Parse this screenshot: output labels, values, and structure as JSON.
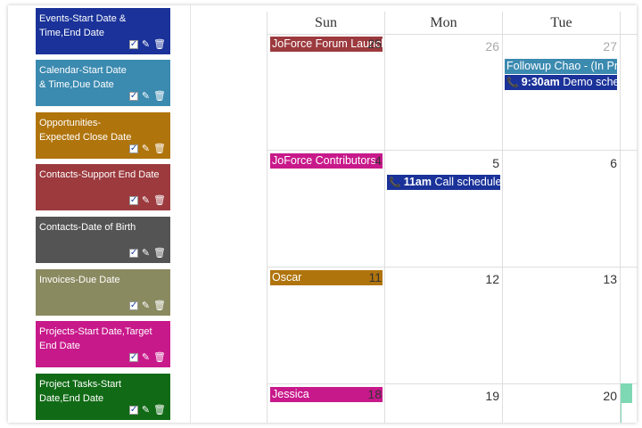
{
  "feeds": [
    {
      "label": "Events-Start Date & Time,End Date",
      "color": "#1a3299"
    },
    {
      "label": "Calendar-Start Date & Time,Due Date",
      "color": "#3b8ab0"
    },
    {
      "label": "Opportunities-Expected Close Date",
      "color": "#b0740c"
    },
    {
      "label": "Contacts-Support End Date",
      "color": "#9c3a3e"
    },
    {
      "label": "Contacts-Date of Birth",
      "color": "#545454"
    },
    {
      "label": "Invoices-Due Date",
      "color": "#8a8a60"
    },
    {
      "label": "Projects-Start Date,Target End Date",
      "color": "#c8198b"
    },
    {
      "label": "Project Tasks-Start Date,End Date",
      "color": "#116b16"
    }
  ],
  "calendar": {
    "headers": [
      "Sun",
      "Mon",
      "Tue"
    ],
    "weeks": [
      {
        "days": [
          "25",
          "26",
          "27"
        ]
      },
      {
        "days": [
          "4",
          "5",
          "6"
        ]
      },
      {
        "days": [
          "11",
          "12",
          "13"
        ]
      },
      {
        "days": [
          "18",
          "19",
          "20"
        ]
      }
    ],
    "events": {
      "w1_sun": {
        "title": "JoForce Forum Launch",
        "color": "#9c3a3e"
      },
      "w1_tue_a": {
        "title": "Followup Chao - (In Progress)",
        "color": "#3b8ab0"
      },
      "w1_tue_b": {
        "time": "9:30am",
        "title": "Demo schedule",
        "color": "#1a3299"
      },
      "w2_sun": {
        "title": "JoForce Contributors",
        "color": "#c8198b"
      },
      "w2_mon": {
        "time": "11am",
        "title": "Call schedule",
        "color": "#1a3299"
      },
      "w3_sun": {
        "title": "Oscar",
        "color": "#b0740c"
      },
      "w4_sun": {
        "title": "Jessica",
        "color": "#c8198b"
      }
    }
  },
  "icons": {
    "checkbox": "checkbox-checked-icon",
    "edit": "pencil-icon",
    "delete": "trash-icon",
    "phone": "phone-icon"
  }
}
